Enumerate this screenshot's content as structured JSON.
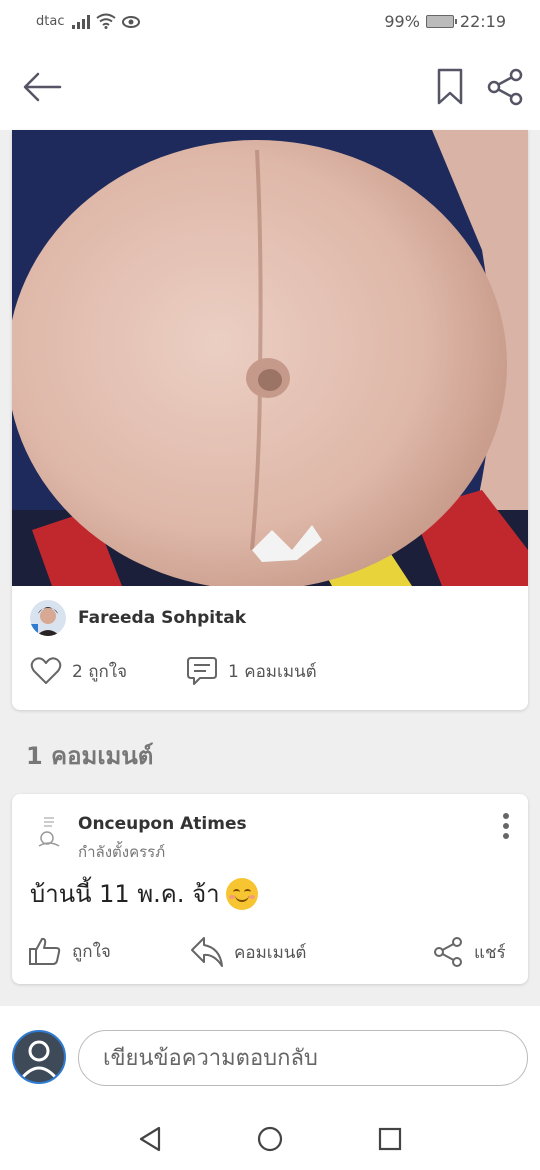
{
  "status_bar": {
    "carrier": "dtac",
    "battery": "99%",
    "time": "22:19"
  },
  "app_bar": {
    "icons": [
      "back-arrow-icon",
      "bookmark-icon",
      "share-icon"
    ]
  },
  "post": {
    "author": "Fareeda Sohpitak",
    "likes_label": "2 ถูกใจ",
    "comments_label": "1 คอมเมนต์"
  },
  "comments_section": {
    "heading": "1 คอมเมนต์"
  },
  "comment": {
    "author": "Onceupon Atimes",
    "status": "กำลังตั้งครรภ์",
    "text": "บ้านนี้ 11 พ.ค. จ้า",
    "like_label": "ถูกใจ",
    "reply_label": "คอมเมนต์",
    "share_label": "แชร์"
  },
  "reply_bar": {
    "placeholder": "เขียนข้อความตอบกลับ"
  },
  "colors": {
    "accent": "#2f7bd2",
    "background": "#efefef"
  }
}
